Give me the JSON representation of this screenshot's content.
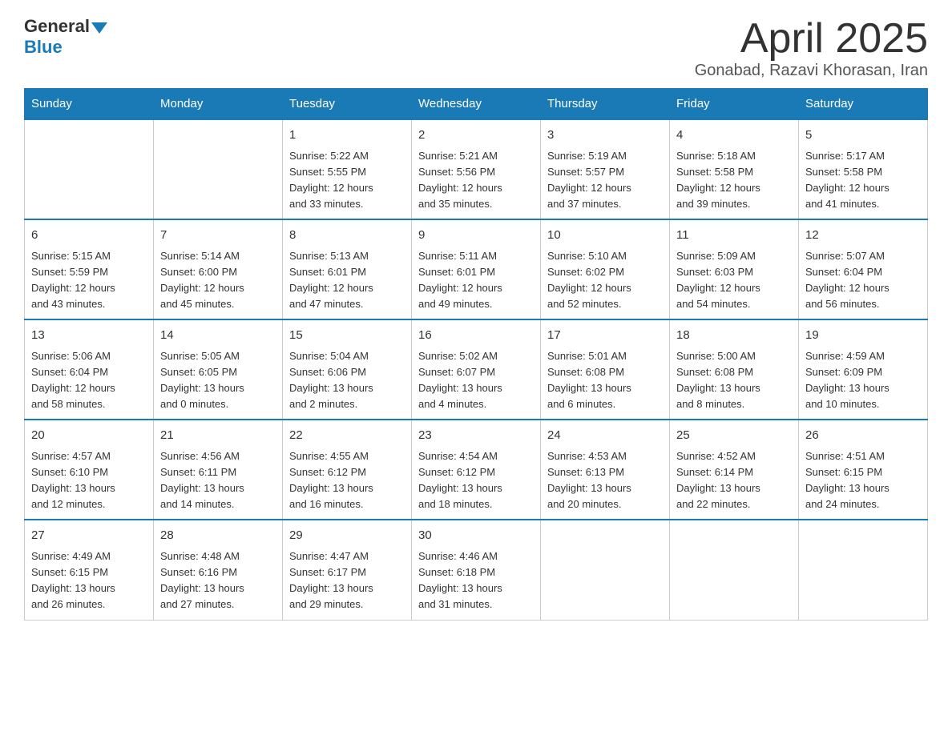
{
  "header": {
    "logo_general": "General",
    "logo_blue": "Blue",
    "month_title": "April 2025",
    "location": "Gonabad, Razavi Khorasan, Iran"
  },
  "days_of_week": [
    "Sunday",
    "Monday",
    "Tuesday",
    "Wednesday",
    "Thursday",
    "Friday",
    "Saturday"
  ],
  "weeks": [
    [
      {
        "day": "",
        "info": ""
      },
      {
        "day": "",
        "info": ""
      },
      {
        "day": "1",
        "info": "Sunrise: 5:22 AM\nSunset: 5:55 PM\nDaylight: 12 hours\nand 33 minutes."
      },
      {
        "day": "2",
        "info": "Sunrise: 5:21 AM\nSunset: 5:56 PM\nDaylight: 12 hours\nand 35 minutes."
      },
      {
        "day": "3",
        "info": "Sunrise: 5:19 AM\nSunset: 5:57 PM\nDaylight: 12 hours\nand 37 minutes."
      },
      {
        "day": "4",
        "info": "Sunrise: 5:18 AM\nSunset: 5:58 PM\nDaylight: 12 hours\nand 39 minutes."
      },
      {
        "day": "5",
        "info": "Sunrise: 5:17 AM\nSunset: 5:58 PM\nDaylight: 12 hours\nand 41 minutes."
      }
    ],
    [
      {
        "day": "6",
        "info": "Sunrise: 5:15 AM\nSunset: 5:59 PM\nDaylight: 12 hours\nand 43 minutes."
      },
      {
        "day": "7",
        "info": "Sunrise: 5:14 AM\nSunset: 6:00 PM\nDaylight: 12 hours\nand 45 minutes."
      },
      {
        "day": "8",
        "info": "Sunrise: 5:13 AM\nSunset: 6:01 PM\nDaylight: 12 hours\nand 47 minutes."
      },
      {
        "day": "9",
        "info": "Sunrise: 5:11 AM\nSunset: 6:01 PM\nDaylight: 12 hours\nand 49 minutes."
      },
      {
        "day": "10",
        "info": "Sunrise: 5:10 AM\nSunset: 6:02 PM\nDaylight: 12 hours\nand 52 minutes."
      },
      {
        "day": "11",
        "info": "Sunrise: 5:09 AM\nSunset: 6:03 PM\nDaylight: 12 hours\nand 54 minutes."
      },
      {
        "day": "12",
        "info": "Sunrise: 5:07 AM\nSunset: 6:04 PM\nDaylight: 12 hours\nand 56 minutes."
      }
    ],
    [
      {
        "day": "13",
        "info": "Sunrise: 5:06 AM\nSunset: 6:04 PM\nDaylight: 12 hours\nand 58 minutes."
      },
      {
        "day": "14",
        "info": "Sunrise: 5:05 AM\nSunset: 6:05 PM\nDaylight: 13 hours\nand 0 minutes."
      },
      {
        "day": "15",
        "info": "Sunrise: 5:04 AM\nSunset: 6:06 PM\nDaylight: 13 hours\nand 2 minutes."
      },
      {
        "day": "16",
        "info": "Sunrise: 5:02 AM\nSunset: 6:07 PM\nDaylight: 13 hours\nand 4 minutes."
      },
      {
        "day": "17",
        "info": "Sunrise: 5:01 AM\nSunset: 6:08 PM\nDaylight: 13 hours\nand 6 minutes."
      },
      {
        "day": "18",
        "info": "Sunrise: 5:00 AM\nSunset: 6:08 PM\nDaylight: 13 hours\nand 8 minutes."
      },
      {
        "day": "19",
        "info": "Sunrise: 4:59 AM\nSunset: 6:09 PM\nDaylight: 13 hours\nand 10 minutes."
      }
    ],
    [
      {
        "day": "20",
        "info": "Sunrise: 4:57 AM\nSunset: 6:10 PM\nDaylight: 13 hours\nand 12 minutes."
      },
      {
        "day": "21",
        "info": "Sunrise: 4:56 AM\nSunset: 6:11 PM\nDaylight: 13 hours\nand 14 minutes."
      },
      {
        "day": "22",
        "info": "Sunrise: 4:55 AM\nSunset: 6:12 PM\nDaylight: 13 hours\nand 16 minutes."
      },
      {
        "day": "23",
        "info": "Sunrise: 4:54 AM\nSunset: 6:12 PM\nDaylight: 13 hours\nand 18 minutes."
      },
      {
        "day": "24",
        "info": "Sunrise: 4:53 AM\nSunset: 6:13 PM\nDaylight: 13 hours\nand 20 minutes."
      },
      {
        "day": "25",
        "info": "Sunrise: 4:52 AM\nSunset: 6:14 PM\nDaylight: 13 hours\nand 22 minutes."
      },
      {
        "day": "26",
        "info": "Sunrise: 4:51 AM\nSunset: 6:15 PM\nDaylight: 13 hours\nand 24 minutes."
      }
    ],
    [
      {
        "day": "27",
        "info": "Sunrise: 4:49 AM\nSunset: 6:15 PM\nDaylight: 13 hours\nand 26 minutes."
      },
      {
        "day": "28",
        "info": "Sunrise: 4:48 AM\nSunset: 6:16 PM\nDaylight: 13 hours\nand 27 minutes."
      },
      {
        "day": "29",
        "info": "Sunrise: 4:47 AM\nSunset: 6:17 PM\nDaylight: 13 hours\nand 29 minutes."
      },
      {
        "day": "30",
        "info": "Sunrise: 4:46 AM\nSunset: 6:18 PM\nDaylight: 13 hours\nand 31 minutes."
      },
      {
        "day": "",
        "info": ""
      },
      {
        "day": "",
        "info": ""
      },
      {
        "day": "",
        "info": ""
      }
    ]
  ]
}
